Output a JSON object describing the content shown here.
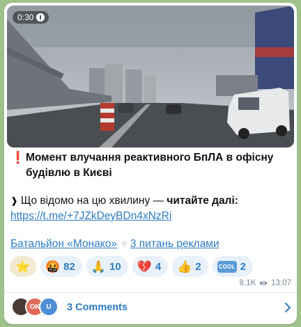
{
  "media": {
    "duration": "0:30"
  },
  "post": {
    "alert_icon": "❗",
    "title": "Момент влучання реактивного БпЛА в офісну будівлю в Києві",
    "bullet_icon": "❱",
    "lead_text": "Що відомо на цю хвилину — ",
    "lead_bold": "читайте далі:",
    "link": "https://t.me/+7JZkDeyBDn4xNzRi",
    "channel_link": "Батальйон «Монако»",
    "separator_icon": "♥",
    "ads_link": "3 питань реклами"
  },
  "reactions": [
    {
      "emoji": "⭐",
      "count": ""
    },
    {
      "emoji": "🤬",
      "count": "82"
    },
    {
      "emoji": "🙏",
      "count": "10"
    },
    {
      "emoji": "💔",
      "count": "4"
    },
    {
      "emoji": "👍",
      "count": "2"
    },
    {
      "emoji": "COOL",
      "count": "2"
    }
  ],
  "meta": {
    "views": "8.1K",
    "time": "13:07"
  },
  "comments": {
    "label": "3 Comments",
    "avatars": [
      "",
      "OK",
      "U"
    ]
  },
  "colors": {
    "accent": "#2e7bbf",
    "background": "#9fc28a",
    "alert": "#e0333a"
  }
}
